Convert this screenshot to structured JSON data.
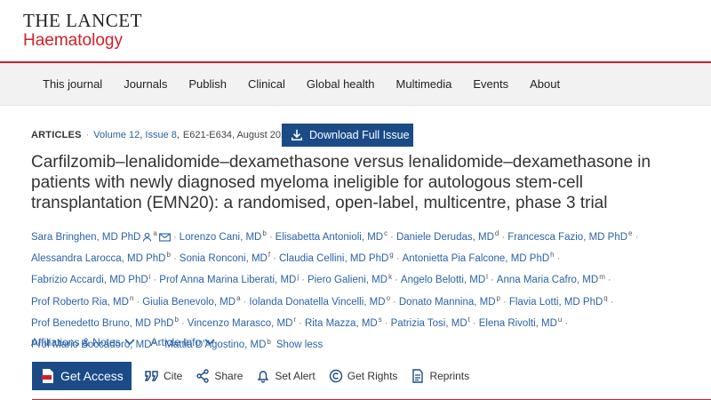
{
  "logo": {
    "line1": "THE LANCET",
    "line2": "Haematology"
  },
  "nav": [
    "This journal",
    "Journals",
    "Publish",
    "Clinical",
    "Global health",
    "Multimedia",
    "Events",
    "About"
  ],
  "meta": {
    "type": "ARTICLES",
    "volume": "Volume 12",
    "issue": "Issue 8",
    "pages": "E621-E634, August 2025",
    "download_label": "Download Full Issue"
  },
  "title": "Carfilzomib–lenalidomide–dexamethasone versus lenalidomide–dexamethasone in patients with newly diagnosed myeloma ineligible for autologous stem-cell transplantation (EMN20): a randomised, open-label, multicentre, phase 3 trial",
  "authors": [
    {
      "name": "Sara Bringhen, MD PhD",
      "sup": "a",
      "icons": true
    },
    {
      "name": "Lorenzo Cani, MD",
      "sup": "b"
    },
    {
      "name": "Elisabetta Antonioli, MD",
      "sup": "c"
    },
    {
      "name": "Daniele Derudas, MD",
      "sup": "d"
    },
    {
      "name": "Francesca Fazio, MD PhD",
      "sup": "e"
    },
    {
      "name": "Alessandra Larocca, MD PhD",
      "sup": "b"
    },
    {
      "name": "Sonia Ronconi, MD",
      "sup": "f"
    },
    {
      "name": "Claudia Cellini, MD PhD",
      "sup": "g"
    },
    {
      "name": "Antonietta Pia Falcone, MD PhD",
      "sup": "h"
    },
    {
      "name": "Fabrizio Accardi, MD PhD",
      "sup": "i"
    },
    {
      "name": "Prof Anna Marina Liberati, MD",
      "sup": "j"
    },
    {
      "name": "Piero Galieni, MD",
      "sup": "k"
    },
    {
      "name": "Angelo Belotti, MD",
      "sup": "l"
    },
    {
      "name": "Anna Maria Cafro, MD",
      "sup": "m"
    },
    {
      "name": "Prof Roberto Ria, MD",
      "sup": "n"
    },
    {
      "name": "Giulia Benevolo, MD",
      "sup": "a"
    },
    {
      "name": "Iolanda Donatella Vincelli, MD",
      "sup": "o"
    },
    {
      "name": "Donato Mannina, MD",
      "sup": "p"
    },
    {
      "name": "Flavia Lotti, MD PhD",
      "sup": "q"
    },
    {
      "name": "Prof Benedetto Bruno, MD PhD",
      "sup": "b"
    },
    {
      "name": "Vincenzo Marasco, MD",
      "sup": "r"
    },
    {
      "name": "Rita Mazza, MD",
      "sup": "s"
    },
    {
      "name": "Patrizia Tosi, MD",
      "sup": "t"
    },
    {
      "name": "Elena Rivolti, MD",
      "sup": "u"
    },
    {
      "name": "Prof Mario Boccadoro, MD",
      "sup": "v"
    },
    {
      "name": "Mattia D'Agostino, MD",
      "sup": "b"
    }
  ],
  "authors_lines": [
    5,
    4,
    5,
    5,
    5,
    2
  ],
  "show_less": "Show less",
  "affiliations_label": "Affiliations & Notes",
  "article_info_label": "Article Info",
  "actions": {
    "get_access": "Get Access",
    "cite": "Cite",
    "share": "Share",
    "set_alert": "Set Alert",
    "get_rights": "Get Rights",
    "reprints": "Reprints"
  },
  "colors": {
    "accent_red": "#d1212a",
    "link_blue": "#2a63a8",
    "button_blue": "#1a4b87"
  },
  "icons": [
    "person-icon",
    "envelope-icon",
    "download-icon",
    "chevron-down-icon",
    "pdf-icon",
    "quote-icon",
    "share-icon",
    "bell-icon",
    "copyright-icon",
    "document-icon"
  ]
}
